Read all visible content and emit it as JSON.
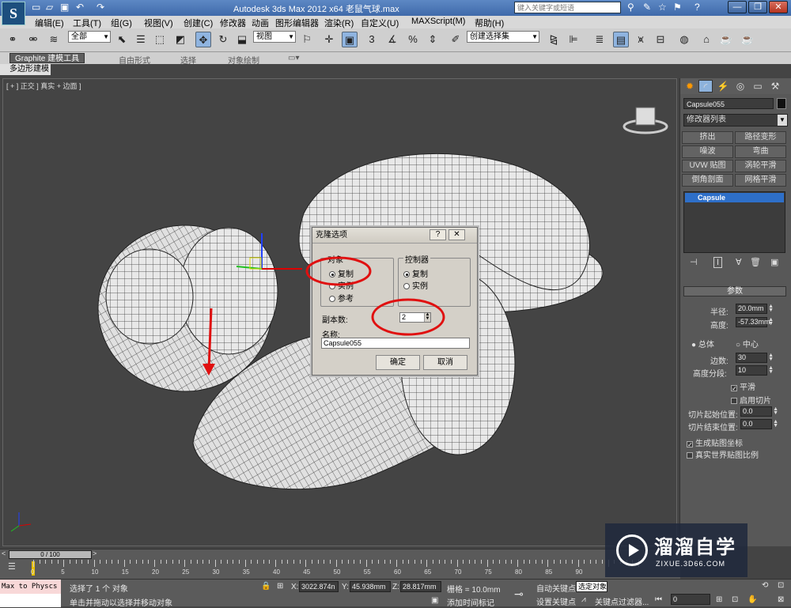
{
  "titlebar": {
    "app_icon": "S",
    "title": "Autodesk 3ds Max  2012 x64    老鼠气球.max",
    "search_placeholder": "键入关键字或短语",
    "win": [
      "—",
      "❐",
      "✕"
    ]
  },
  "menu": [
    "编辑(E)",
    "工具(T)",
    "组(G)",
    "视图(V)",
    "创建(C)",
    "修改器",
    "动画",
    "图形编辑器",
    "渲染(R)",
    "自定义(U)",
    "MAXScript(M)",
    "帮助(H)"
  ],
  "toolbar": {
    "selection_filter": "全部",
    "ref_coord": "视图",
    "named_selection": "创建选择集",
    "snap_label": "3"
  },
  "ribbon": {
    "tabs": [
      "Graphite 建模工具",
      "自由形式",
      "选择",
      "对象绘制"
    ],
    "sub": "多边形建模"
  },
  "viewport": {
    "label": "[ + ] 正交 ] 真实 + 边面 ]"
  },
  "dialog": {
    "title": "克隆选项",
    "object_group": "对象",
    "object_options": [
      "复制",
      "实例",
      "参考"
    ],
    "controller_group": "控制器",
    "controller_options": [
      "复制",
      "实例"
    ],
    "copies_label": "副本数:",
    "copies_value": "2",
    "name_label": "名称:",
    "name_value": "Capsule055",
    "ok": "确定",
    "cancel": "取消"
  },
  "panel": {
    "object_name": "Capsule055",
    "modifier_list": "修改器列表",
    "mod_buttons": [
      "挤出",
      "路径变形",
      "噪波",
      "弯曲",
      "UVW 贴图",
      "涡轮平滑",
      "倒角剖面",
      "网格平滑"
    ],
    "stack_item": "Capsule",
    "rollout": "参数",
    "radius_label": "半径:",
    "radius": "20.0mm",
    "height_label": "高度:",
    "height": "-57.33mm",
    "overall": "总体",
    "center": "中心",
    "sides_label": "边数:",
    "sides": "30",
    "hsegs_label": "高度分段:",
    "hsegs": "10",
    "smooth": "平滑",
    "slice_on": "启用切片",
    "slice_from_label": "切片起始位置:",
    "slice_from": "0.0",
    "slice_to_label": "切片结束位置:",
    "slice_to": "0.0",
    "gen_uv": "生成贴图坐标",
    "real_world": "真实世界贴图比例"
  },
  "timeline": {
    "frame": "0 / 100",
    "ticks": [
      "0",
      "5",
      "10",
      "15",
      "20",
      "25",
      "30",
      "35",
      "40",
      "45",
      "50",
      "55",
      "60",
      "65",
      "70",
      "75",
      "80",
      "85",
      "90"
    ]
  },
  "status": {
    "script_line1": "Max to Physcs (",
    "script_line2": "",
    "selected": "选择了 1 个 对象",
    "hint": "单击并拖动以选择并移动对象",
    "x_label": "X:",
    "x": "3022.874n",
    "y_label": "Y:",
    "y": "45.938mm",
    "z_label": "Z:",
    "z": "28.817mm",
    "grid": "栅格 = 10.0mm",
    "autokey": "自动关键点",
    "selected_obj": "选定对象",
    "setkey": "设置关键点",
    "keyfilter": "关键点过滤器...",
    "add_time_tag": "添加时间标记",
    "frame_field": "0"
  },
  "watermark": {
    "cn": "溜溜自学",
    "en": "ZIXUE.3D66.COM"
  },
  "colors": {
    "accent": "#8fb4e0",
    "highlight": "#2e6fc8",
    "annotation": "#e01010"
  }
}
